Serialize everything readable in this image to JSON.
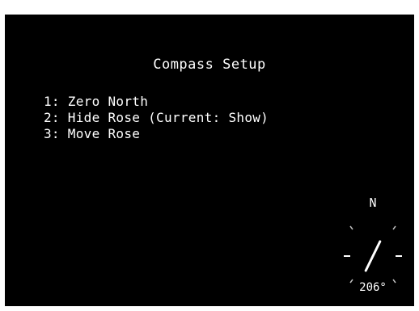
{
  "screen": {
    "title": "Compass Setup",
    "menu": [
      "1: Zero North",
      "2: Hide Rose (Current: Show)",
      "3: Move Rose"
    ]
  },
  "compass": {
    "north_label": "N",
    "heading_text": "206°",
    "heading_degrees": 206
  },
  "colors": {
    "background": "#000000",
    "text": "#ffffff"
  }
}
